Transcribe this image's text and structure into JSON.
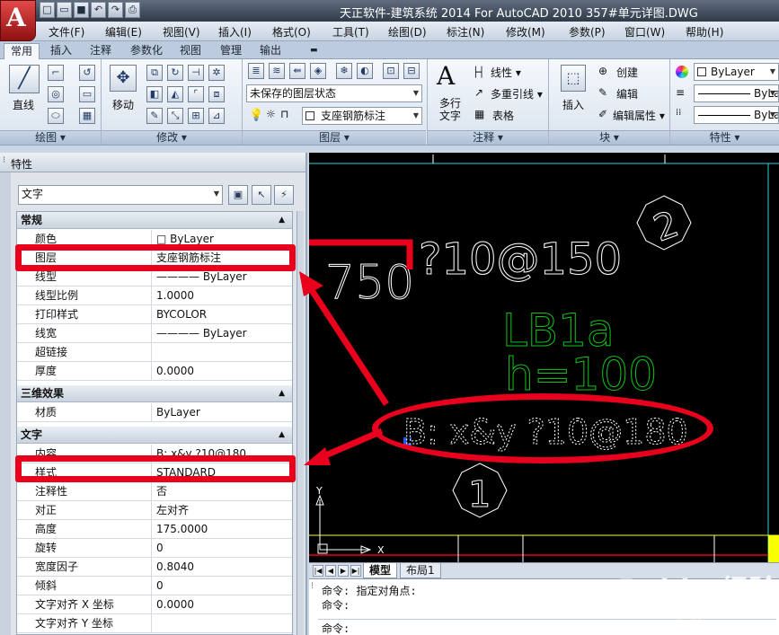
{
  "window": {
    "title": "天正软件-建筑系统 2014  For AutoCAD 2010      357#单元详图.DWG",
    "app_button_letter": "A"
  },
  "quick_access": [
    "new-icon",
    "open-icon",
    "save-icon",
    "undo-icon",
    "redo-icon",
    "print-icon"
  ],
  "menubar": [
    "文件(F)",
    "编辑(E)",
    "视图(V)",
    "插入(I)",
    "格式(O)",
    "工具(T)",
    "绘图(D)",
    "标注(N)",
    "修改(M)",
    "参数(P)",
    "窗口(W)",
    "帮助(H)"
  ],
  "ribbon_tabs": [
    "常用",
    "插入",
    "注释",
    "参数化",
    "视图",
    "管理",
    "输出"
  ],
  "ribbon": {
    "draw": {
      "line_label": "直线",
      "panel": "绘图 ▾"
    },
    "modify": {
      "move_label": "移动",
      "panel": "修改 ▾"
    },
    "layers": {
      "state": "未保存的图层状态",
      "current_layer": "支座钢筋标注",
      "panel": "图层 ▾"
    },
    "annotation": {
      "mtext_label": "多行\n文字",
      "linear": "线性 ▾",
      "mleader": "多重引线 ▾",
      "table": "表格",
      "panel": "注释 ▾"
    },
    "block": {
      "insert": "插入",
      "create": "创建",
      "edit": "编辑",
      "edit_attr": "编辑属性 ▾",
      "panel": "块 ▾"
    },
    "properties": {
      "color": "ByLayer",
      "linetype": "ByLayer",
      "lineweight": "ByLay",
      "panel": "特性 ▾"
    }
  },
  "properties_palette": {
    "title": "特性",
    "object_type": "文字",
    "sections": [
      {
        "name": "常规",
        "rows": [
          {
            "k": "颜色",
            "v": "□ ByLayer"
          },
          {
            "k": "图层",
            "v": "支座钢筋标注"
          },
          {
            "k": "线型",
            "v": "———— ByLayer"
          },
          {
            "k": "线型比例",
            "v": "1.0000"
          },
          {
            "k": "打印样式",
            "v": "BYCOLOR"
          },
          {
            "k": "线宽",
            "v": "———— ByLayer"
          },
          {
            "k": "超链接",
            "v": ""
          },
          {
            "k": "厚度",
            "v": "0.0000"
          }
        ]
      },
      {
        "name": "三维效果",
        "rows": [
          {
            "k": "材质",
            "v": "ByLayer"
          }
        ]
      },
      {
        "name": "文字",
        "rows": [
          {
            "k": "内容",
            "v": "B:  x&y  ?10@180"
          },
          {
            "k": "样式",
            "v": "STANDARD"
          },
          {
            "k": "注释性",
            "v": "否"
          },
          {
            "k": "对正",
            "v": "左对齐"
          },
          {
            "k": "高度",
            "v": "175.0000"
          },
          {
            "k": "旋转",
            "v": "0"
          },
          {
            "k": "宽度因子",
            "v": "0.8040"
          },
          {
            "k": "倾斜",
            "v": "0"
          },
          {
            "k": "文字对齐 X 坐标",
            "v": "0.0000"
          },
          {
            "k": "文字对齐 Y 坐标",
            "v": ""
          }
        ]
      }
    ]
  },
  "drawing": {
    "texts": {
      "dim": "750",
      "rebar_top": "?10@150",
      "label": "LB1a",
      "thickness": "h=100",
      "bottom_rebar": "B:  x&y  ?10@180",
      "circle_2": "2",
      "circle_1": "1",
      "axis_y": "Y",
      "axis_x": "X"
    }
  },
  "layout_tabs": [
    "模型",
    "布局1"
  ],
  "command_line": [
    "命令: 指定对角点:",
    "命令:",
    "命令:"
  ],
  "watermark": {
    "text": "Baidu 经验",
    "url": "jingyan.baidu.com"
  },
  "colors": {
    "highlight": "#e8001c",
    "cad_bg": "#000000",
    "green_text": "#12c41a",
    "cyan": "#2ad6e0",
    "yellow": "#f7ff00"
  }
}
